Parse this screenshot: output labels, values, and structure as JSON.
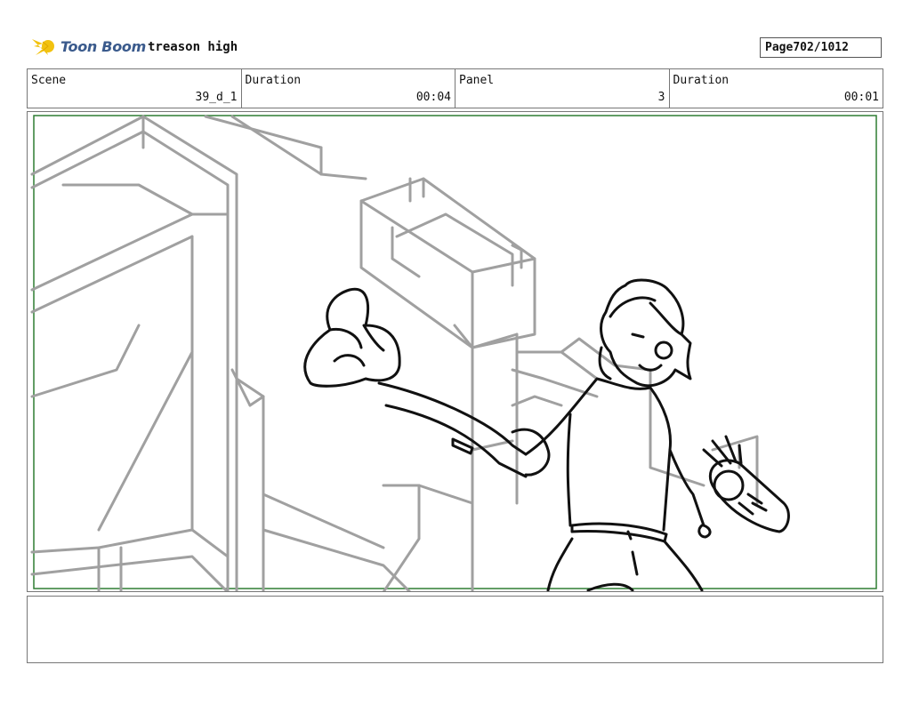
{
  "header": {
    "brand_name": "Toon Boom",
    "project_title": "treason high",
    "page_label": "Page",
    "page_value": "702/1012"
  },
  "info": {
    "scene_label": "Scene",
    "scene_value": "39_d_1",
    "scene_duration_label": "Duration",
    "scene_duration_value": "00:04",
    "panel_label": "Panel",
    "panel_value": "3",
    "panel_duration_label": "Duration",
    "panel_duration_value": "00:01"
  },
  "colors": {
    "frame_border": "#2e7d32",
    "background_sketch": "#a0a0a0",
    "character_line": "#111111",
    "brand_blue": "#3a5a8c",
    "brand_yellow": "#f2c20f"
  }
}
